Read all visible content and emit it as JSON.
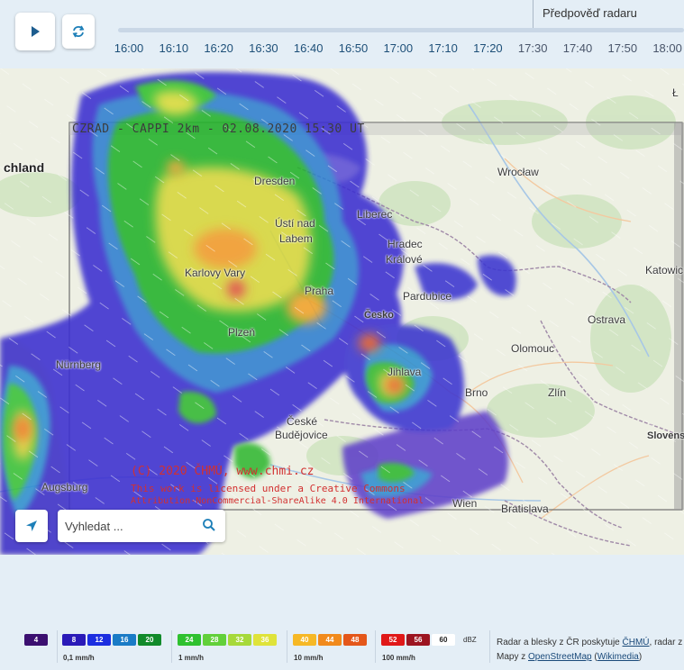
{
  "timeline": {
    "ticks": [
      "16:00",
      "16:10",
      "16:20",
      "16:30",
      "16:40",
      "16:50",
      "17:00",
      "17:10",
      "17:20",
      "17:30",
      "17:40",
      "17:50",
      "18:00"
    ],
    "past_count": 9,
    "forecast_label": "Předpověď radaru"
  },
  "map": {
    "radar_header": "CZRAD - CAPPI 2km - 02.08.2020 15:30 UT",
    "copyright_line1": "(C) 2020 ČHMÚ, www.chmi.cz",
    "copyright_line2": "This work is licensed under a Creative Commons",
    "copyright_line3": "Attribution-NonCommercial-ShareAlike 4.0 International",
    "places": [
      {
        "name": "chland",
        "cls": "big"
      },
      {
        "name": "Dresden",
        "cls": ""
      },
      {
        "name": "Wrocław",
        "cls": ""
      },
      {
        "name": "Liberec",
        "cls": ""
      },
      {
        "name": "Ústí nad",
        "cls": ""
      },
      {
        "name": "Labem",
        "cls": ""
      },
      {
        "name": "Hradec",
        "cls": ""
      },
      {
        "name": "Králové",
        "cls": ""
      },
      {
        "name": "Katowic",
        "cls": ""
      },
      {
        "name": "Karlovy Vary",
        "cls": ""
      },
      {
        "name": "Praha",
        "cls": ""
      },
      {
        "name": "Pardubice",
        "cls": ""
      },
      {
        "name": "Česko",
        "cls": "bold"
      },
      {
        "name": "Ostrava",
        "cls": ""
      },
      {
        "name": "Plzeň",
        "cls": ""
      },
      {
        "name": "Olomouc",
        "cls": ""
      },
      {
        "name": "Nürnberg",
        "cls": ""
      },
      {
        "name": "Jihlava",
        "cls": ""
      },
      {
        "name": "Brno",
        "cls": ""
      },
      {
        "name": "Zlín",
        "cls": ""
      },
      {
        "name": "České",
        "cls": ""
      },
      {
        "name": "Budějovice",
        "cls": ""
      },
      {
        "name": "Slovens",
        "cls": "bold"
      },
      {
        "name": "Augsburg",
        "cls": ""
      },
      {
        "name": "Wien",
        "cls": ""
      },
      {
        "name": "Bratislava",
        "cls": ""
      },
      {
        "name": "Ł",
        "cls": ""
      }
    ]
  },
  "search": {
    "placeholder": "Vyhledat ..."
  },
  "legend": {
    "groups": [
      {
        "items": [
          {
            "label": "4",
            "color": "#3b0f70"
          }
        ],
        "rate": ""
      },
      {
        "items": [
          {
            "label": "8",
            "color": "#2a1ab8"
          },
          {
            "label": "12",
            "color": "#1c2ee0"
          },
          {
            "label": "16",
            "color": "#1a7bc6"
          },
          {
            "label": "20",
            "color": "#118a2a"
          }
        ],
        "rate": "0,1 mm/h"
      },
      {
        "items": [
          {
            "label": "24",
            "color": "#2fc12f"
          },
          {
            "label": "28",
            "color": "#62d03a"
          },
          {
            "label": "32",
            "color": "#a6d93a"
          },
          {
            "label": "36",
            "color": "#dfe33a"
          }
        ],
        "rate": "1 mm/h"
      },
      {
        "items": [
          {
            "label": "40",
            "color": "#f6b826"
          },
          {
            "label": "44",
            "color": "#f18a1c"
          },
          {
            "label": "48",
            "color": "#e4571a"
          }
        ],
        "rate": "10 mm/h"
      },
      {
        "items": [
          {
            "label": "52",
            "color": "#e01818"
          },
          {
            "label": "56",
            "color": "#9c1420"
          },
          {
            "label": "60",
            "color": "#ffffff"
          }
        ],
        "rate": "100 mm/h"
      }
    ],
    "unit": "dBZ",
    "credits_prefix": "Radar a blesky z ČR poskytuje",
    "credits_chmu": "ČHMÚ",
    "credits_middle": ", radar z",
    "credits_maps": "Mapy z",
    "credits_osm": "OpenStreetMap",
    "credits_wiki": "Wikimedia"
  },
  "colors": {
    "accent": "#1d4f78",
    "background": "#e4eef6"
  }
}
